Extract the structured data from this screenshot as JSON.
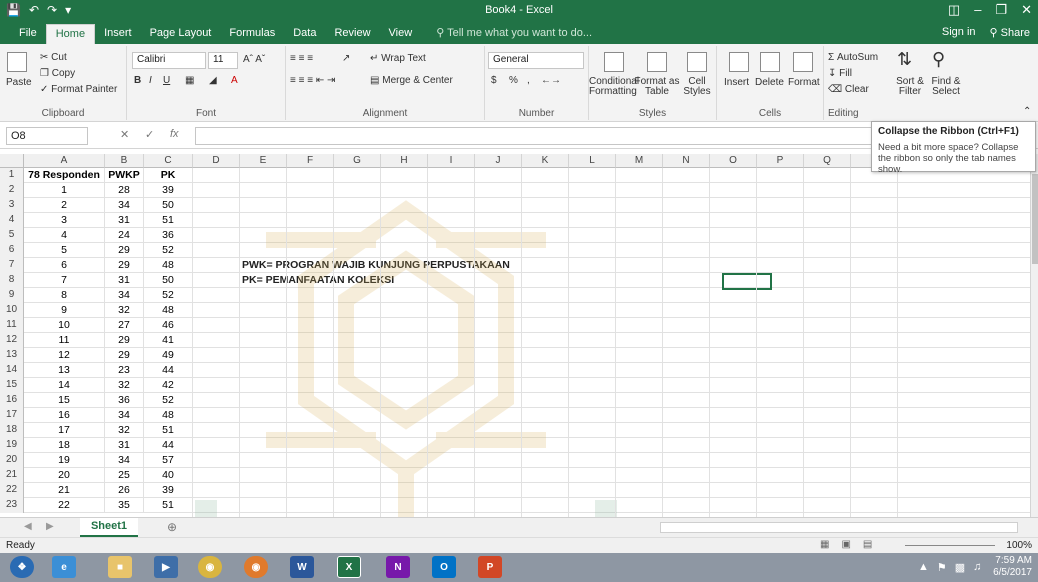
{
  "window": {
    "title": "Book4 - Excel",
    "qat": [
      "save-icon",
      "undo-icon",
      "redo-icon",
      "customize-icon"
    ],
    "controls": [
      "ribbon-display-icon",
      "minimize-icon",
      "restore-icon",
      "close-icon"
    ]
  },
  "menu": {
    "tabs": [
      "File",
      "Home",
      "Insert",
      "Page Layout",
      "Formulas",
      "Data",
      "Review",
      "View"
    ],
    "active": "Home",
    "tellme": "Tell me what you want to do...",
    "sign_in": "Sign in",
    "share": "Share"
  },
  "ribbon": {
    "clipboard": {
      "label": "Clipboard",
      "paste": "Paste",
      "cut": "Cut",
      "copy": "Copy",
      "format_painter": "Format Painter"
    },
    "font": {
      "label": "Font",
      "name": "Calibri",
      "size": "11"
    },
    "alignment": {
      "label": "Alignment",
      "wrap": "Wrap Text",
      "merge": "Merge & Center"
    },
    "number": {
      "label": "Number",
      "format": "General",
      "currency": "$",
      "percent": "%"
    },
    "styles": {
      "label": "Styles",
      "conditional": "Conditional Formatting",
      "format_table": "Format as Table",
      "cell_styles": "Cell Styles"
    },
    "cells": {
      "label": "Cells",
      "insert": "Insert",
      "delete": "Delete",
      "format": "Format"
    },
    "editing": {
      "label": "Editing",
      "autosum": "AutoSum",
      "fill": "Fill",
      "clear": "Clear",
      "sort": "Sort & Filter",
      "find": "Find & Select"
    }
  },
  "formula_bar": {
    "name_box": "O8",
    "fx": "fx",
    "value": ""
  },
  "tooltip": {
    "title": "Collapse the Ribbon (Ctrl+F1)",
    "body": "Need a bit more space? Collapse the ribbon so only the tab names show."
  },
  "columns": [
    "A",
    "B",
    "C",
    "D",
    "E",
    "F",
    "G",
    "H",
    "I",
    "J",
    "K",
    "L",
    "M",
    "N",
    "O",
    "P",
    "Q",
    "R",
    "S"
  ],
  "header_row": [
    "78 Responden",
    "PWKP",
    "PK"
  ],
  "data_rows": [
    [
      1,
      28,
      39
    ],
    [
      2,
      34,
      50
    ],
    [
      3,
      31,
      51
    ],
    [
      4,
      24,
      36
    ],
    [
      5,
      29,
      52
    ],
    [
      6,
      29,
      48
    ],
    [
      7,
      31,
      50
    ],
    [
      8,
      34,
      52
    ],
    [
      9,
      32,
      48
    ],
    [
      10,
      27,
      46
    ],
    [
      11,
      29,
      41
    ],
    [
      12,
      29,
      49
    ],
    [
      13,
      23,
      44
    ],
    [
      14,
      32,
      42
    ],
    [
      15,
      36,
      52
    ],
    [
      16,
      34,
      48
    ],
    [
      17,
      32,
      51
    ],
    [
      18,
      31,
      44
    ],
    [
      19,
      34,
      57
    ],
    [
      20,
      25,
      40
    ],
    [
      21,
      26,
      39
    ],
    [
      22,
      35,
      51
    ]
  ],
  "notes": {
    "row7": "PWK= PROGRAN WAJIB KUNJUNG PERPUSTAKAAN",
    "row8": "PK= PEMANFAATAN KOLEKSI"
  },
  "sheets": {
    "active": "Sheet1"
  },
  "status": {
    "ready": "Ready",
    "zoom": "100%"
  },
  "taskbar": {
    "time": "7:59 AM",
    "date": "6/5/2017",
    "apps": [
      "start-icon",
      "ie-icon",
      "explorer-icon",
      "media-icon",
      "chrome-icon",
      "firefox-icon",
      "word-icon",
      "excel-icon",
      "onenote-icon",
      "outlook-icon",
      "powerpoint-icon"
    ]
  },
  "colors": {
    "excel_green": "#217346",
    "ribbon_bg": "#f3f3f3"
  }
}
